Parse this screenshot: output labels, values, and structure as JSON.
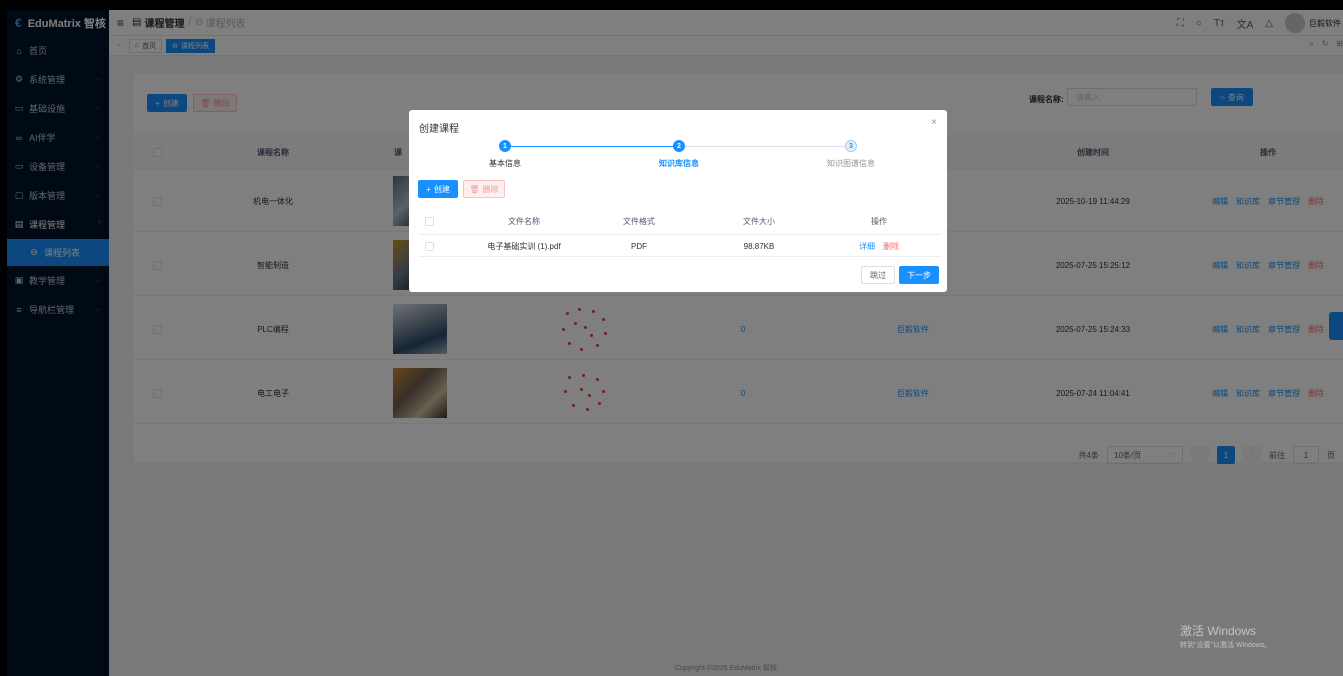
{
  "app": {
    "logo": "EduMatrix 智核"
  },
  "sidebar": {
    "items": [
      {
        "label": "首页"
      },
      {
        "label": "系统管理"
      },
      {
        "label": "基础设施"
      },
      {
        "label": "AI伴学"
      },
      {
        "label": "设备管理"
      },
      {
        "label": "版本管理"
      },
      {
        "label": "课程管理"
      },
      {
        "label": "课程列表"
      },
      {
        "label": "教学管理"
      },
      {
        "label": "导航栏管理"
      }
    ]
  },
  "header": {
    "breadcrumb_1": "课程管理",
    "breadcrumb_sep": "/",
    "breadcrumb_2": "课程列表",
    "font_label": "Tт",
    "translate_label": "文A",
    "username": "巨毅软件"
  },
  "tags": {
    "home": "首页",
    "course_list": "课程列表"
  },
  "toolbar": {
    "create_label": "创建",
    "delete_label": "删除",
    "search_label": "课程名称:",
    "search_placeholder": "请输入",
    "query_label": "查询"
  },
  "table": {
    "columns": {
      "name": "课程名称",
      "cover": "课",
      "created": "创建时间",
      "ops": "操作"
    },
    "rows": [
      {
        "name": "机电一体化",
        "count": "",
        "author": "",
        "created": "2025-10-19 11:44:29"
      },
      {
        "name": "智能制造",
        "count": "",
        "author": "",
        "created": "2025-07-25 15:25:12"
      },
      {
        "name": "PLC编程",
        "count": "0",
        "author": "巨毅软件",
        "created": "2025-07-25 15:24:33"
      },
      {
        "name": "电工电子",
        "count": "0",
        "author": "巨毅软件",
        "created": "2025-07-24 11:04:41"
      }
    ],
    "ops": {
      "edit": "编辑",
      "kb": "知识库",
      "chapter": "章节管理",
      "delete": "删除"
    }
  },
  "pager": {
    "total": "共4条",
    "page_size": "10条/页",
    "current": "1",
    "goto_label": "前往",
    "goto_value": "1",
    "page_unit": "页"
  },
  "footer": "Copyright ©2025 EduMatrix 智核",
  "watermark": {
    "line1": "激活 Windows",
    "line2": "转到\"设置\"以激活 Windows。"
  },
  "dialog": {
    "title": "创建课程",
    "close": "×",
    "steps": [
      {
        "num": "1",
        "label": "基本信息"
      },
      {
        "num": "2",
        "label": "知识库信息"
      },
      {
        "num": "3",
        "label": "知识图谱信息"
      }
    ],
    "create_label": "创建",
    "delete_label": "删除",
    "columns": {
      "file_name": "文件名称",
      "file_format": "文件格式",
      "file_size": "文件大小",
      "ops": "操作"
    },
    "files": [
      {
        "name": "电子基础实训 (1).pdf",
        "format": "PDF",
        "size": "98.87KB",
        "detail": "详细",
        "delete": "删除"
      }
    ],
    "skip_label": "跳过",
    "next_label": "下一步"
  },
  "colors": {
    "primary": "#1890ff",
    "sidebar": "#001529",
    "danger": "#f56c6c"
  }
}
